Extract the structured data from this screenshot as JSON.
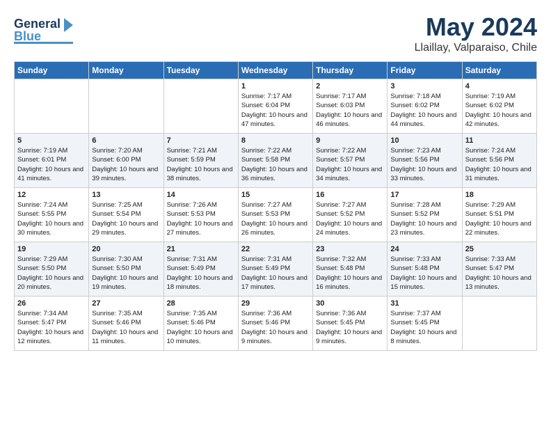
{
  "logo": {
    "line1": "General",
    "line2": "Blue"
  },
  "title": "May 2024",
  "subtitle": "Llaillay, Valparaiso, Chile",
  "headers": [
    "Sunday",
    "Monday",
    "Tuesday",
    "Wednesday",
    "Thursday",
    "Friday",
    "Saturday"
  ],
  "weeks": [
    [
      {
        "num": "",
        "sunrise": "",
        "sunset": "",
        "daylight": ""
      },
      {
        "num": "",
        "sunrise": "",
        "sunset": "",
        "daylight": ""
      },
      {
        "num": "",
        "sunrise": "",
        "sunset": "",
        "daylight": ""
      },
      {
        "num": "1",
        "sunrise": "Sunrise: 7:17 AM",
        "sunset": "Sunset: 6:04 PM",
        "daylight": "Daylight: 10 hours and 47 minutes."
      },
      {
        "num": "2",
        "sunrise": "Sunrise: 7:17 AM",
        "sunset": "Sunset: 6:03 PM",
        "daylight": "Daylight: 10 hours and 46 minutes."
      },
      {
        "num": "3",
        "sunrise": "Sunrise: 7:18 AM",
        "sunset": "Sunset: 6:02 PM",
        "daylight": "Daylight: 10 hours and 44 minutes."
      },
      {
        "num": "4",
        "sunrise": "Sunrise: 7:19 AM",
        "sunset": "Sunset: 6:02 PM",
        "daylight": "Daylight: 10 hours and 42 minutes."
      }
    ],
    [
      {
        "num": "5",
        "sunrise": "Sunrise: 7:19 AM",
        "sunset": "Sunset: 6:01 PM",
        "daylight": "Daylight: 10 hours and 41 minutes."
      },
      {
        "num": "6",
        "sunrise": "Sunrise: 7:20 AM",
        "sunset": "Sunset: 6:00 PM",
        "daylight": "Daylight: 10 hours and 39 minutes."
      },
      {
        "num": "7",
        "sunrise": "Sunrise: 7:21 AM",
        "sunset": "Sunset: 5:59 PM",
        "daylight": "Daylight: 10 hours and 38 minutes."
      },
      {
        "num": "8",
        "sunrise": "Sunrise: 7:22 AM",
        "sunset": "Sunset: 5:58 PM",
        "daylight": "Daylight: 10 hours and 36 minutes."
      },
      {
        "num": "9",
        "sunrise": "Sunrise: 7:22 AM",
        "sunset": "Sunset: 5:57 PM",
        "daylight": "Daylight: 10 hours and 34 minutes."
      },
      {
        "num": "10",
        "sunrise": "Sunrise: 7:23 AM",
        "sunset": "Sunset: 5:56 PM",
        "daylight": "Daylight: 10 hours and 33 minutes."
      },
      {
        "num": "11",
        "sunrise": "Sunrise: 7:24 AM",
        "sunset": "Sunset: 5:56 PM",
        "daylight": "Daylight: 10 hours and 31 minutes."
      }
    ],
    [
      {
        "num": "12",
        "sunrise": "Sunrise: 7:24 AM",
        "sunset": "Sunset: 5:55 PM",
        "daylight": "Daylight: 10 hours and 30 minutes."
      },
      {
        "num": "13",
        "sunrise": "Sunrise: 7:25 AM",
        "sunset": "Sunset: 5:54 PM",
        "daylight": "Daylight: 10 hours and 29 minutes."
      },
      {
        "num": "14",
        "sunrise": "Sunrise: 7:26 AM",
        "sunset": "Sunset: 5:53 PM",
        "daylight": "Daylight: 10 hours and 27 minutes."
      },
      {
        "num": "15",
        "sunrise": "Sunrise: 7:27 AM",
        "sunset": "Sunset: 5:53 PM",
        "daylight": "Daylight: 10 hours and 26 minutes."
      },
      {
        "num": "16",
        "sunrise": "Sunrise: 7:27 AM",
        "sunset": "Sunset: 5:52 PM",
        "daylight": "Daylight: 10 hours and 24 minutes."
      },
      {
        "num": "17",
        "sunrise": "Sunrise: 7:28 AM",
        "sunset": "Sunset: 5:52 PM",
        "daylight": "Daylight: 10 hours and 23 minutes."
      },
      {
        "num": "18",
        "sunrise": "Sunrise: 7:29 AM",
        "sunset": "Sunset: 5:51 PM",
        "daylight": "Daylight: 10 hours and 22 minutes."
      }
    ],
    [
      {
        "num": "19",
        "sunrise": "Sunrise: 7:29 AM",
        "sunset": "Sunset: 5:50 PM",
        "daylight": "Daylight: 10 hours and 20 minutes."
      },
      {
        "num": "20",
        "sunrise": "Sunrise: 7:30 AM",
        "sunset": "Sunset: 5:50 PM",
        "daylight": "Daylight: 10 hours and 19 minutes."
      },
      {
        "num": "21",
        "sunrise": "Sunrise: 7:31 AM",
        "sunset": "Sunset: 5:49 PM",
        "daylight": "Daylight: 10 hours and 18 minutes."
      },
      {
        "num": "22",
        "sunrise": "Sunrise: 7:31 AM",
        "sunset": "Sunset: 5:49 PM",
        "daylight": "Daylight: 10 hours and 17 minutes."
      },
      {
        "num": "23",
        "sunrise": "Sunrise: 7:32 AM",
        "sunset": "Sunset: 5:48 PM",
        "daylight": "Daylight: 10 hours and 16 minutes."
      },
      {
        "num": "24",
        "sunrise": "Sunrise: 7:33 AM",
        "sunset": "Sunset: 5:48 PM",
        "daylight": "Daylight: 10 hours and 15 minutes."
      },
      {
        "num": "25",
        "sunrise": "Sunrise: 7:33 AM",
        "sunset": "Sunset: 5:47 PM",
        "daylight": "Daylight: 10 hours and 13 minutes."
      }
    ],
    [
      {
        "num": "26",
        "sunrise": "Sunrise: 7:34 AM",
        "sunset": "Sunset: 5:47 PM",
        "daylight": "Daylight: 10 hours and 12 minutes."
      },
      {
        "num": "27",
        "sunrise": "Sunrise: 7:35 AM",
        "sunset": "Sunset: 5:46 PM",
        "daylight": "Daylight: 10 hours and 11 minutes."
      },
      {
        "num": "28",
        "sunrise": "Sunrise: 7:35 AM",
        "sunset": "Sunset: 5:46 PM",
        "daylight": "Daylight: 10 hours and 10 minutes."
      },
      {
        "num": "29",
        "sunrise": "Sunrise: 7:36 AM",
        "sunset": "Sunset: 5:46 PM",
        "daylight": "Daylight: 10 hours and 9 minutes."
      },
      {
        "num": "30",
        "sunrise": "Sunrise: 7:36 AM",
        "sunset": "Sunset: 5:45 PM",
        "daylight": "Daylight: 10 hours and 9 minutes."
      },
      {
        "num": "31",
        "sunrise": "Sunrise: 7:37 AM",
        "sunset": "Sunset: 5:45 PM",
        "daylight": "Daylight: 10 hours and 8 minutes."
      },
      {
        "num": "",
        "sunrise": "",
        "sunset": "",
        "daylight": ""
      }
    ]
  ]
}
